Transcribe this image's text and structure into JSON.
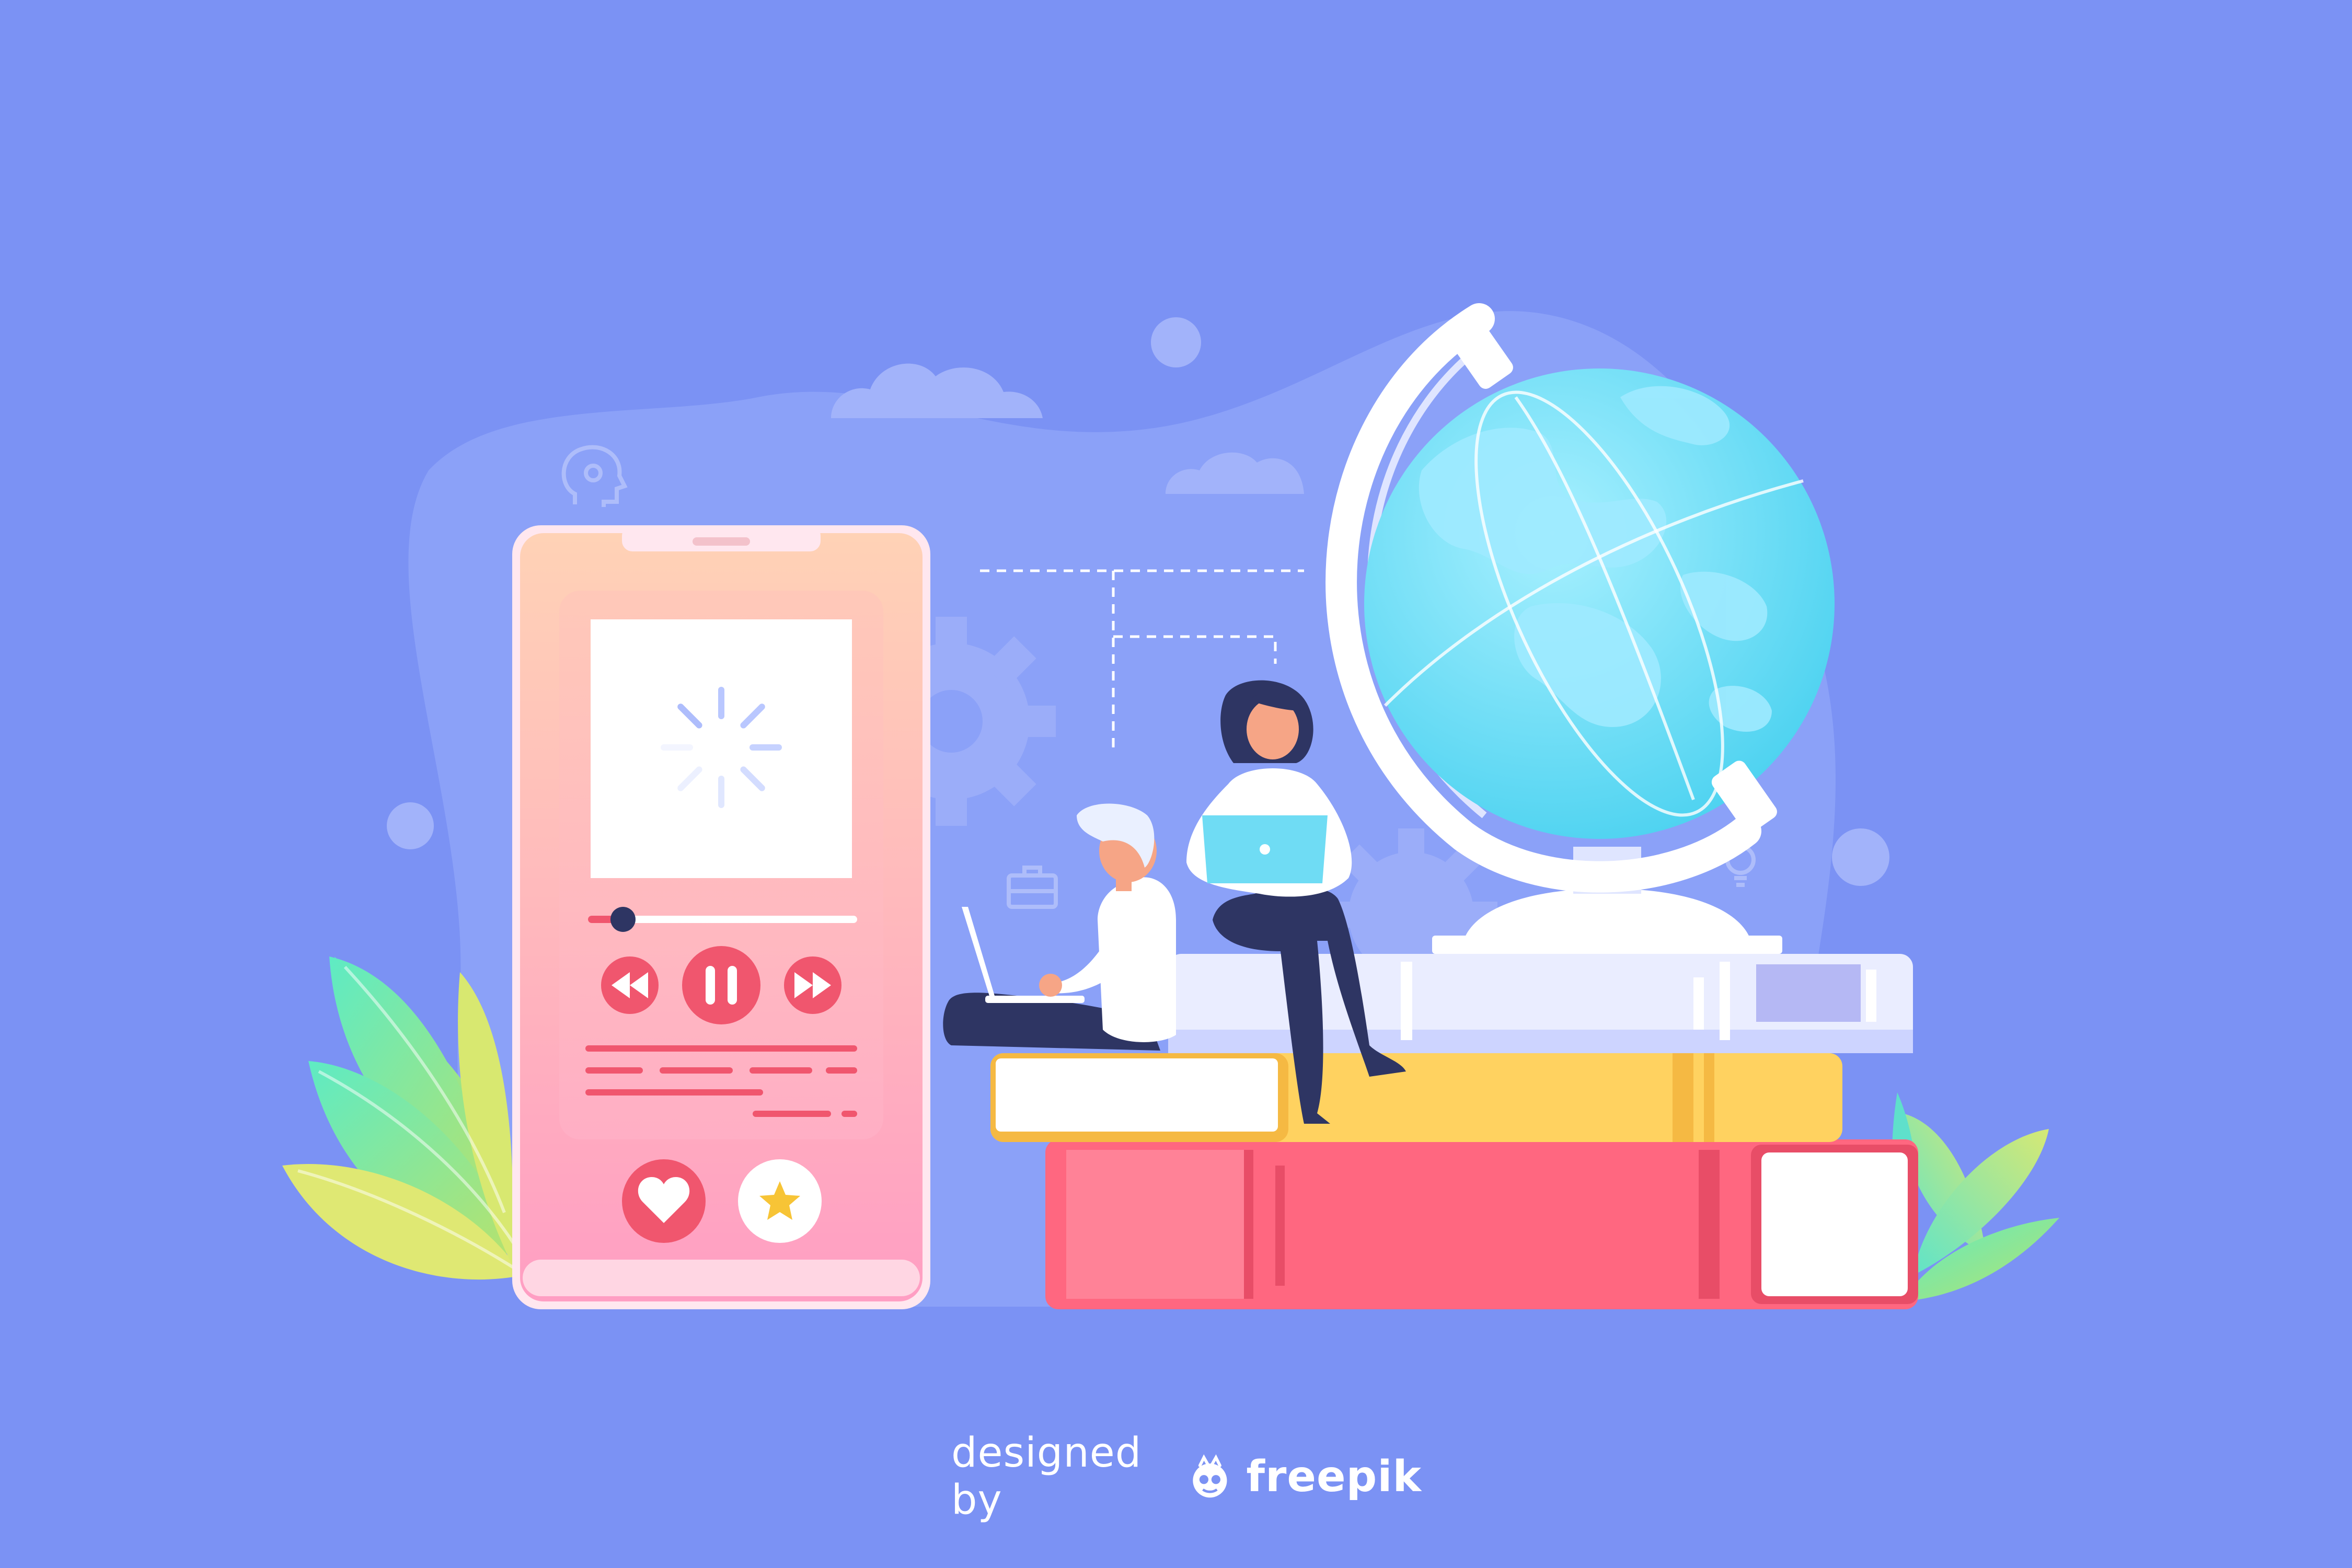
{
  "credit": {
    "prefix": "designed by",
    "brand": "freepik"
  },
  "colors": {
    "background": "#7b92f4",
    "phone_top": "#ffd0b8",
    "phone_bottom": "#ff9fc0",
    "accent_red": "#f0566e",
    "globe": "#63d9f5",
    "book_red": "#ff6780",
    "book_yellow": "#ffd260",
    "book_white": "#e5e8ff"
  },
  "player": {
    "progress_fraction": 0.13
  },
  "icons": [
    "loading-spinner-icon",
    "rewind-icon",
    "pause-icon",
    "fast-forward-icon",
    "heart-icon",
    "star-icon",
    "head-gear-icon",
    "briefcase-icon",
    "lightbulb-icon",
    "gear-icon",
    "freepik-logo-icon"
  ]
}
